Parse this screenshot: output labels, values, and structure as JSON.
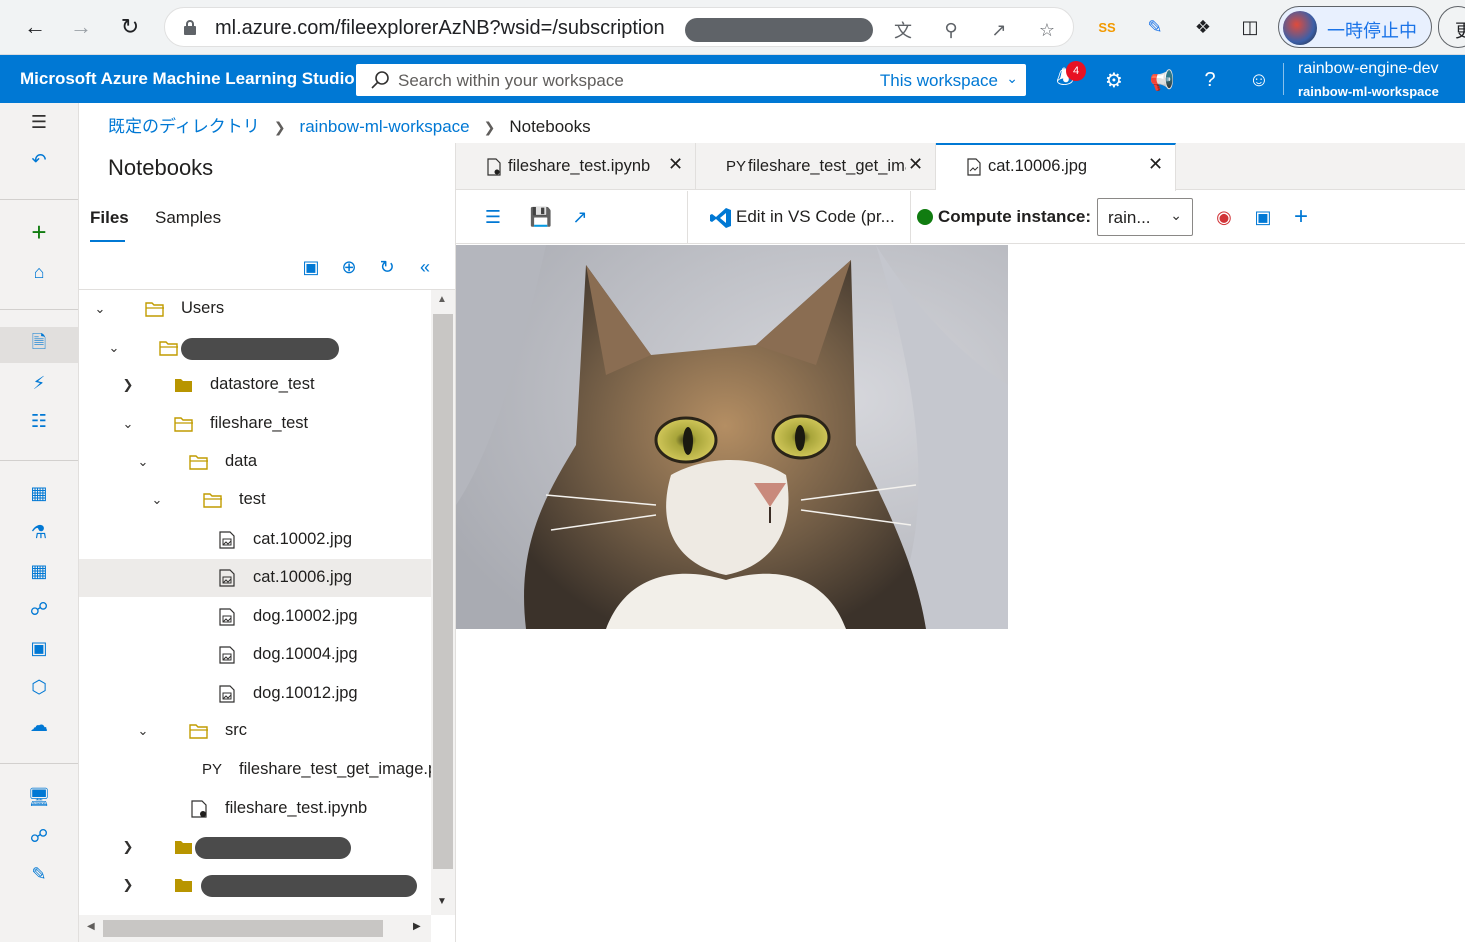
{
  "browser": {
    "url": "ml.azure.com/fileexplorerAzNB?wsid=/subscription",
    "profile_label": "一時停止中",
    "edge_label": "更"
  },
  "header": {
    "brand": "Microsoft Azure Machine Learning Studio",
    "search_placeholder": "Search within your workspace",
    "search_scope": "This workspace",
    "notification_count": "4",
    "user_name": "rainbow-engine-dev",
    "workspace_name": "rainbow-ml-workspace",
    "accent": "#0078d4"
  },
  "breadcrumb": {
    "items": [
      "既定のディレクトリ",
      "rainbow-ml-workspace",
      "Notebooks"
    ]
  },
  "panel": {
    "title": "Notebooks",
    "tabs": [
      "Files",
      "Samples"
    ],
    "active_tab": "Files"
  },
  "tree": [
    {
      "label": "Users",
      "type": "folder-open",
      "expanded": true,
      "depth": 0
    },
    {
      "label": "",
      "type": "folder-open",
      "expanded": true,
      "depth": 1,
      "redacted": true
    },
    {
      "label": "datastore_test",
      "type": "folder-closed",
      "expanded": false,
      "depth": 2
    },
    {
      "label": "fileshare_test",
      "type": "folder-open",
      "expanded": true,
      "depth": 2
    },
    {
      "label": "data",
      "type": "folder-open",
      "expanded": true,
      "depth": 3
    },
    {
      "label": "test",
      "type": "folder-open",
      "expanded": true,
      "depth": 4
    },
    {
      "label": "cat.10002.jpg",
      "type": "image-file",
      "depth": 5
    },
    {
      "label": "cat.10006.jpg",
      "type": "image-file",
      "depth": 5,
      "selected": true
    },
    {
      "label": "dog.10002.jpg",
      "type": "image-file",
      "depth": 5
    },
    {
      "label": "dog.10004.jpg",
      "type": "image-file",
      "depth": 5
    },
    {
      "label": "dog.10012.jpg",
      "type": "image-file",
      "depth": 5
    },
    {
      "label": "src",
      "type": "folder-open",
      "expanded": true,
      "depth": 3
    },
    {
      "label": "fileshare_test_get_image.py",
      "type": "python-file",
      "depth": 4,
      "prefix": "PY"
    },
    {
      "label": "fileshare_test.ipynb",
      "type": "notebook-file",
      "depth": 3
    },
    {
      "label": "",
      "type": "folder-closed",
      "expanded": false,
      "depth": 1,
      "redacted": true
    },
    {
      "label": "",
      "type": "folder-closed",
      "expanded": false,
      "depth": 1,
      "redacted": true
    }
  ],
  "editor_tabs": [
    {
      "label": "fileshare_test.ipynb",
      "icon": "notebook-icon"
    },
    {
      "label": "fileshare_test_get_image.py",
      "icon": "py",
      "prefix": "PY"
    },
    {
      "label": "cat.10006.jpg",
      "icon": "image-icon",
      "active": true
    }
  ],
  "toolbar": {
    "vscode_label": "Edit in VS Code (pr...",
    "compute_label": "Compute instance:",
    "compute_value": "rain...",
    "compute_status_color": "#107c10"
  },
  "image_view": {
    "file": "cat.10006.jpg"
  }
}
